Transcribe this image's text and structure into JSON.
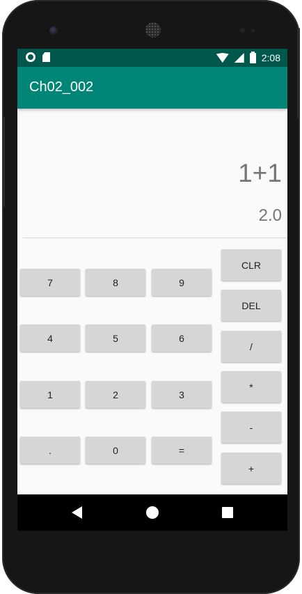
{
  "status_bar": {
    "time": "2:08"
  },
  "app_bar": {
    "title": "Ch02_002"
  },
  "display": {
    "expression": "1+1",
    "result": "2.0"
  },
  "keypad": {
    "rows": [
      [
        "7",
        "8",
        "9"
      ],
      [
        "4",
        "5",
        "6"
      ],
      [
        "1",
        "2",
        "3"
      ],
      [
        ".",
        "0",
        "="
      ]
    ],
    "operators": [
      "CLR",
      "DEL",
      "/",
      "*",
      "-",
      "+"
    ]
  },
  "colors": {
    "status_bar": "#00574b",
    "app_bar": "#008577",
    "key_background": "#d6d6d6",
    "display_text": "#757575"
  },
  "icons": {
    "status_left": [
      "circle-notification-icon",
      "sd-card-icon"
    ],
    "status_right": [
      "wifi-icon",
      "cell-signal-icon",
      "battery-icon"
    ],
    "nav": [
      "back-icon",
      "home-icon",
      "recents-icon"
    ]
  }
}
